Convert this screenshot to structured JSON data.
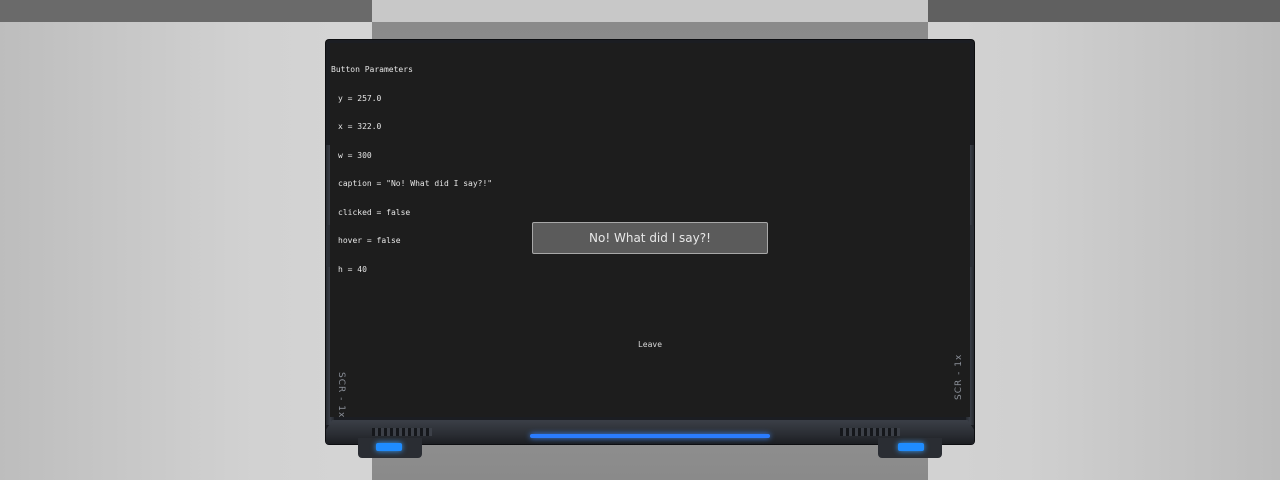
{
  "screen": {
    "debug_title": "Button Parameters",
    "debug_lines": [
      "y = 257.0",
      "x = 322.0",
      "w = 300",
      "caption = \"No! What did I say?!\"",
      "clicked = false",
      "hover = false",
      "h = 40"
    ],
    "button_caption": "No! What did I say?!",
    "leave_label": "Leave"
  },
  "hardware": {
    "model_label_left": "SCR - 1x",
    "model_label_right": "SCR - 1x",
    "accent_color": "#2a7cff"
  }
}
